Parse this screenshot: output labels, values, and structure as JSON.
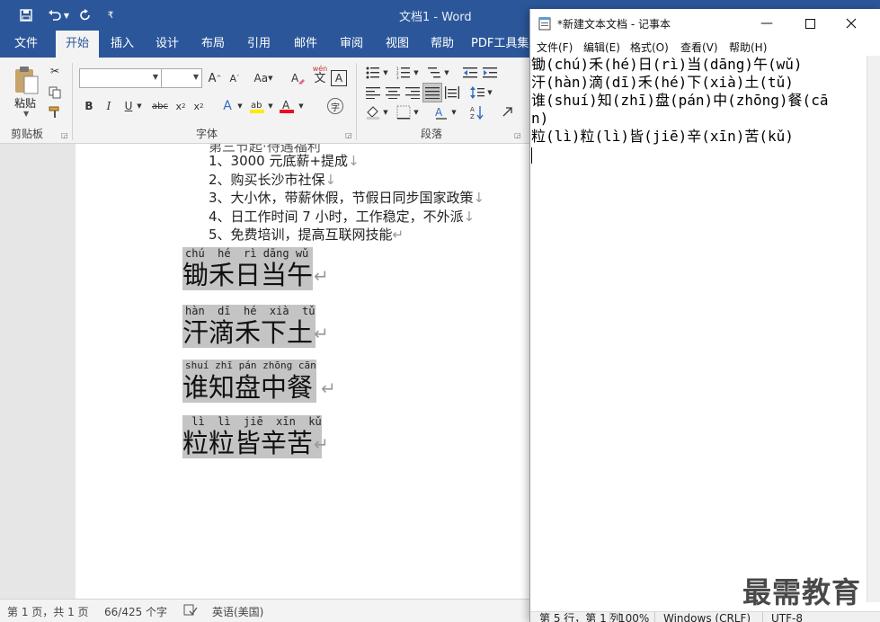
{
  "word": {
    "title": "文档1  -  Word",
    "quick_access": [
      "save-icon",
      "undo-icon",
      "redo-icon",
      "customize-icon"
    ],
    "tabs": [
      "文件",
      "开始",
      "插入",
      "设计",
      "布局",
      "引用",
      "邮件",
      "审阅",
      "视图",
      "帮助",
      "PDF工具集"
    ],
    "active_tab": "开始",
    "ribbon": {
      "clipboard": {
        "paste_label": "粘贴",
        "group_label": "剪贴板"
      },
      "font": {
        "group_label": "字体",
        "font_name": "",
        "font_size": "",
        "change_case": "Aa",
        "phonetic_label": "wén"
      },
      "paragraph": {
        "group_label": "段落"
      }
    },
    "document": {
      "partial_line": "第三节起·待遇福利",
      "bullets": [
        "1、3000 元底薪+提成",
        "2、购买长沙市社保",
        "3、大小休，带薪休假，节假日同步国家政策",
        "4、日工作时间 7 小时，工作稳定，不外派",
        "5、免费培训，提高互联网技能"
      ],
      "ruby_lines": [
        {
          "pinyin": "chú  hé  rì dāng wǔ",
          "hanzi": "锄禾日当午"
        },
        {
          "pinyin": "hàn  dī  hé  xià  tǔ",
          "hanzi": "汗滴禾下土"
        },
        {
          "pinyin": "shuí zhī pán zhōng cān",
          "hanzi": "谁知盘中餐"
        },
        {
          "pinyin": " lì  lì  jiē  xīn  kǔ",
          "hanzi": "粒粒皆辛苦"
        }
      ],
      "para_mark": "↵",
      "line_mark": "↓"
    },
    "status": {
      "page": "第 1 页，共 1 页",
      "words": "66/425 个字",
      "language": "英语(美国)"
    }
  },
  "notepad": {
    "title": "*新建文本文档 - 记事本",
    "menu": [
      "文件(F)",
      "编辑(E)",
      "格式(O)",
      "查看(V)",
      "帮助(H)"
    ],
    "lines": [
      "锄(chú)禾(hé)日(rì)当(dāng)午(wǔ)",
      "汗(hàn)滴(dī)禾(hé)下(xià)土(tǔ)",
      "谁(shuí)知(zhī)盘(pán)中(zhōng)餐(cā",
      "n)",
      "粒(lì)粒(lì)皆(jiē)辛(xīn)苦(kǔ)"
    ],
    "status": {
      "position": "第 5 行，第 1 列",
      "zoom": "100%",
      "line_ending": "Windows (CRLF)",
      "encoding": "UTF-8"
    }
  },
  "watermark": "最需教育",
  "colors": {
    "word_blue": "#2b579a",
    "ribbon_bg": "#f3f3f3",
    "highlight": "#c4c4c4"
  }
}
